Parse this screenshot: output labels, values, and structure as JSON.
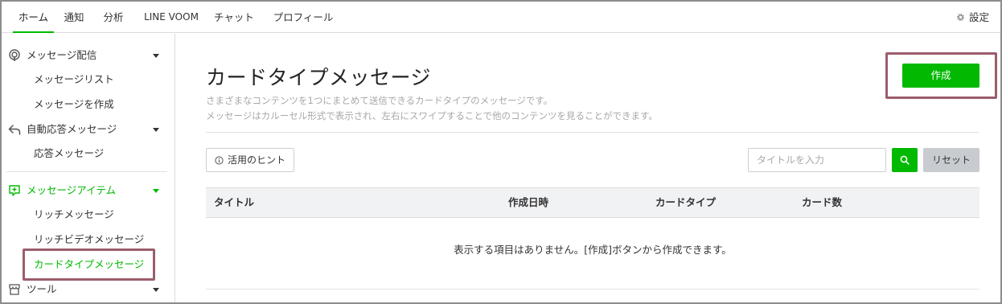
{
  "topnav": {
    "tabs": [
      "ホーム",
      "通知",
      "分析",
      "LINE VOOM",
      "チャット",
      "プロフィール"
    ],
    "active_tab": "ホーム",
    "settings_label": "設定"
  },
  "sidebar": {
    "sections": [
      {
        "label": "メッセージ配信",
        "icon": "broadcast-icon",
        "items": [
          "メッセージリスト",
          "メッセージを作成"
        ]
      },
      {
        "label": "自動応答メッセージ",
        "icon": "reply-arrow-icon",
        "items": [
          "応答メッセージ"
        ]
      },
      {
        "label": "メッセージアイテム",
        "icon": "plus-square-icon",
        "items": [
          "リッチメッセージ",
          "リッチビデオメッセージ",
          "カードタイプメッセージ"
        ]
      },
      {
        "label": "ツール",
        "icon": "store-icon",
        "items": []
      }
    ],
    "active_item": "カードタイプメッセージ"
  },
  "main": {
    "title": "カードタイプメッセージ",
    "description": [
      "さまざまなコンテンツを1つにまとめて送信できるカードタイプのメッセージです。",
      "メッセージはカルーセル形式で表示され、左右にスワイプすることで他のコンテンツを見ることができます。"
    ],
    "create_label": "作成",
    "hint_label": "活用のヒント",
    "search_placeholder": "タイトルを入力",
    "search_value": "",
    "reset_label": "リセット",
    "table": {
      "columns": [
        "タイトル",
        "作成日時",
        "カードタイプ",
        "カード数"
      ],
      "rows": [],
      "empty_message": "表示する項目はありません。[作成]ボタンから作成できます。"
    }
  },
  "colors": {
    "accent": "#00b900",
    "highlight": "#9c5d6b",
    "header_bg": "#f1f2f4"
  }
}
